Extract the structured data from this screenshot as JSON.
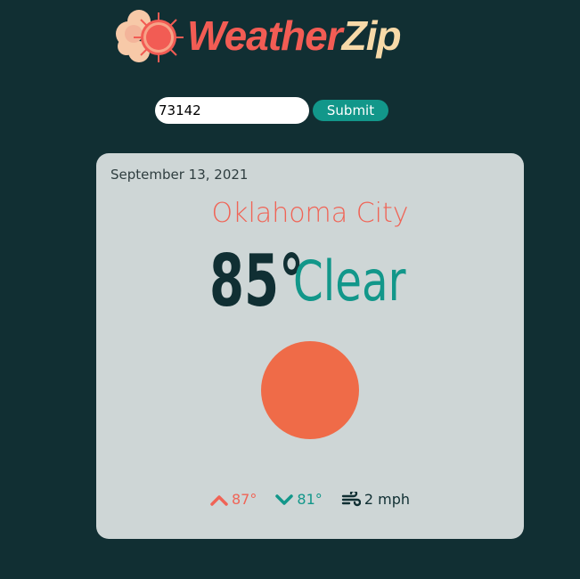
{
  "brand": {
    "name_part1": "Weather",
    "name_part2": "Zip",
    "logo_icon": "sun-cloud-icon"
  },
  "search": {
    "value": "73142",
    "submit_label": "Submit"
  },
  "weather": {
    "date": "September 13, 2021",
    "city": "Oklahoma City",
    "temperature": "85°",
    "condition": "Clear",
    "condition_icon": "sun-icon",
    "high": "87°",
    "low": "81°",
    "wind": "2 mph"
  },
  "colors": {
    "background": "#112f33",
    "card": "#ced6d6",
    "accent_coral": "#f06456",
    "accent_teal": "#12978a",
    "sun": "#ef6b48"
  }
}
